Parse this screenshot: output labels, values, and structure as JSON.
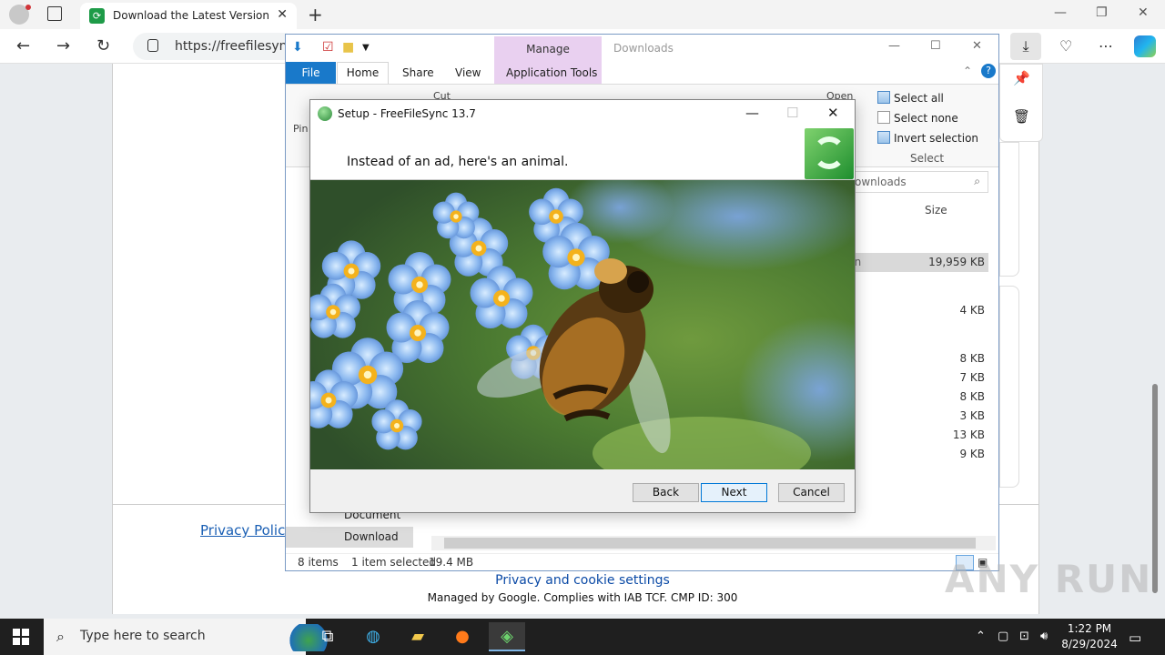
{
  "browser": {
    "tab_title": "Download the Latest Version - Fre",
    "url": "https://freefilesync.c",
    "colors": {
      "accent": "#0078d4"
    }
  },
  "page": {
    "privacy_policy": "Privacy Policy",
    "cookie_settings": "Privacy and cookie settings",
    "managed_by": "Managed by Google. Complies with IAB TCF. CMP ID: 300"
  },
  "explorer": {
    "manage_tab": "Manage",
    "path_title": "Downloads",
    "tabs": {
      "file": "File",
      "home": "Home",
      "share": "Share",
      "view": "View",
      "app_tools": "Application Tools"
    },
    "ribbon": {
      "cut": "Cut",
      "pin": "Pin",
      "open": "Open",
      "select_all": "Select all",
      "select_none": "Select none",
      "invert_selection": "Invert selection",
      "select_group": "Select"
    },
    "search_placeholder": "ownloads",
    "column_size": "Size",
    "rows": [
      {
        "name": "ion",
        "size": "19,959 KB",
        "selected": true
      },
      {
        "name": "",
        "size": "4 KB"
      },
      {
        "name": "",
        "size": "8 KB"
      },
      {
        "name": "",
        "size": "7 KB"
      },
      {
        "name": "",
        "size": "8 KB"
      },
      {
        "name": "",
        "size": "3 KB"
      },
      {
        "name": "",
        "size": "13 KB"
      },
      {
        "name": "",
        "size": "9 KB"
      }
    ],
    "nav": {
      "documents": "Document",
      "downloads": "Download"
    },
    "status": {
      "items": "8 items",
      "selected": "1 item selected",
      "size": "19.4 MB"
    }
  },
  "setup": {
    "title": "Setup - FreeFileSync 13.7",
    "message": "Instead of an ad, here's an animal.",
    "buttons": {
      "back": "Back",
      "next": "Next",
      "cancel": "Cancel"
    }
  },
  "taskbar": {
    "search_placeholder": "Type here to search",
    "time": "1:22 PM",
    "date": "8/29/2024"
  },
  "watermark": "ANY RUN"
}
